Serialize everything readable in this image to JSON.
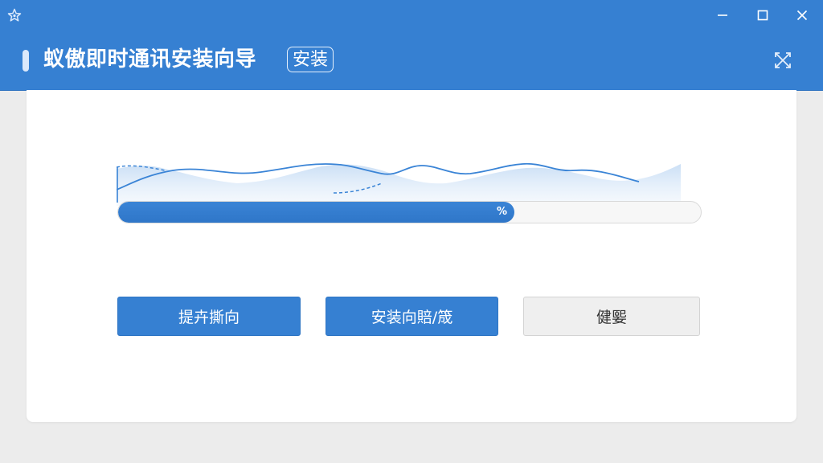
{
  "window": {
    "app_icon": "star-icon",
    "controls": {
      "minimize": "minimize-icon",
      "maximize": "maximize-icon",
      "close": "close-icon"
    }
  },
  "header": {
    "title": "蚁傲即时通讯安装向导",
    "badge": "安装",
    "close_icon": "expand-cross-icon"
  },
  "progress": {
    "percent": 68,
    "label": "%"
  },
  "buttons": [
    {
      "label": "提卉撕向"
    },
    {
      "label": "安装向賠/筬"
    },
    {
      "label": "健媐"
    }
  ],
  "colors": {
    "primary": "#3680d2",
    "header_bg": "#3680d2",
    "card_bg": "#ffffff",
    "page_bg": "#ececec",
    "secondary_button": "#efefef"
  }
}
